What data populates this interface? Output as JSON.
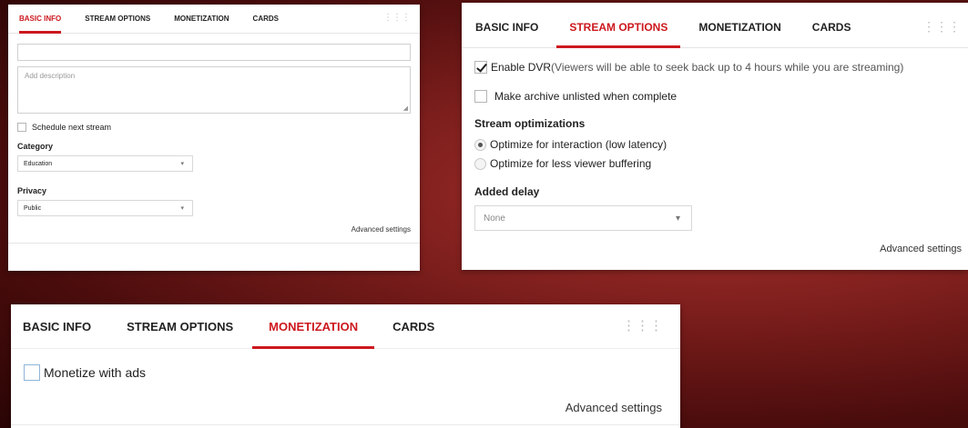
{
  "basic_info_panel": {
    "tabs": [
      "BASIC INFO",
      "STREAM OPTIONS",
      "MONETIZATION",
      "CARDS"
    ],
    "active_tab": "BASIC INFO",
    "title_value": "",
    "description_placeholder": "Add description",
    "schedule_next_stream_label": "Schedule next stream",
    "schedule_next_stream_checked": false,
    "category_label": "Category",
    "category_value": "Education",
    "privacy_label": "Privacy",
    "privacy_value": "Public",
    "advanced_settings": "Advanced settings"
  },
  "stream_options_panel": {
    "tabs": [
      "BASIC INFO",
      "STREAM OPTIONS",
      "MONETIZATION",
      "CARDS"
    ],
    "active_tab": "STREAM OPTIONS",
    "enable_dvr_label": "Enable DVR",
    "enable_dvr_detail": " (Viewers will be able to seek back up to 4 hours while you are streaming)",
    "enable_dvr_checked": true,
    "unlisted_label": "Make archive unlisted when complete",
    "unlisted_checked": false,
    "optimizations_label": "Stream optimizations",
    "option_low_latency": "Optimize for interaction (low latency)",
    "option_less_buffering": "Optimize for less viewer buffering",
    "selected_optimization": "Optimize for interaction (low latency)",
    "added_delay_label": "Added delay",
    "added_delay_value": "None",
    "advanced_settings": "Advanced settings"
  },
  "monetization_panel": {
    "tabs": [
      "BASIC INFO",
      "STREAM OPTIONS",
      "MONETIZATION",
      "CARDS"
    ],
    "active_tab": "MONETIZATION",
    "monetize_label": "Monetize with ads",
    "monetize_checked": false,
    "advanced_settings": "Advanced settings"
  },
  "icons": {
    "grid": "grid-dots-icon",
    "dropdown": "chevron-down-icon",
    "checkmark": "checkmark-icon",
    "resize": "resize-handle-icon"
  },
  "colors": {
    "accent": "#cc181e",
    "background": "#7e1f1d"
  }
}
